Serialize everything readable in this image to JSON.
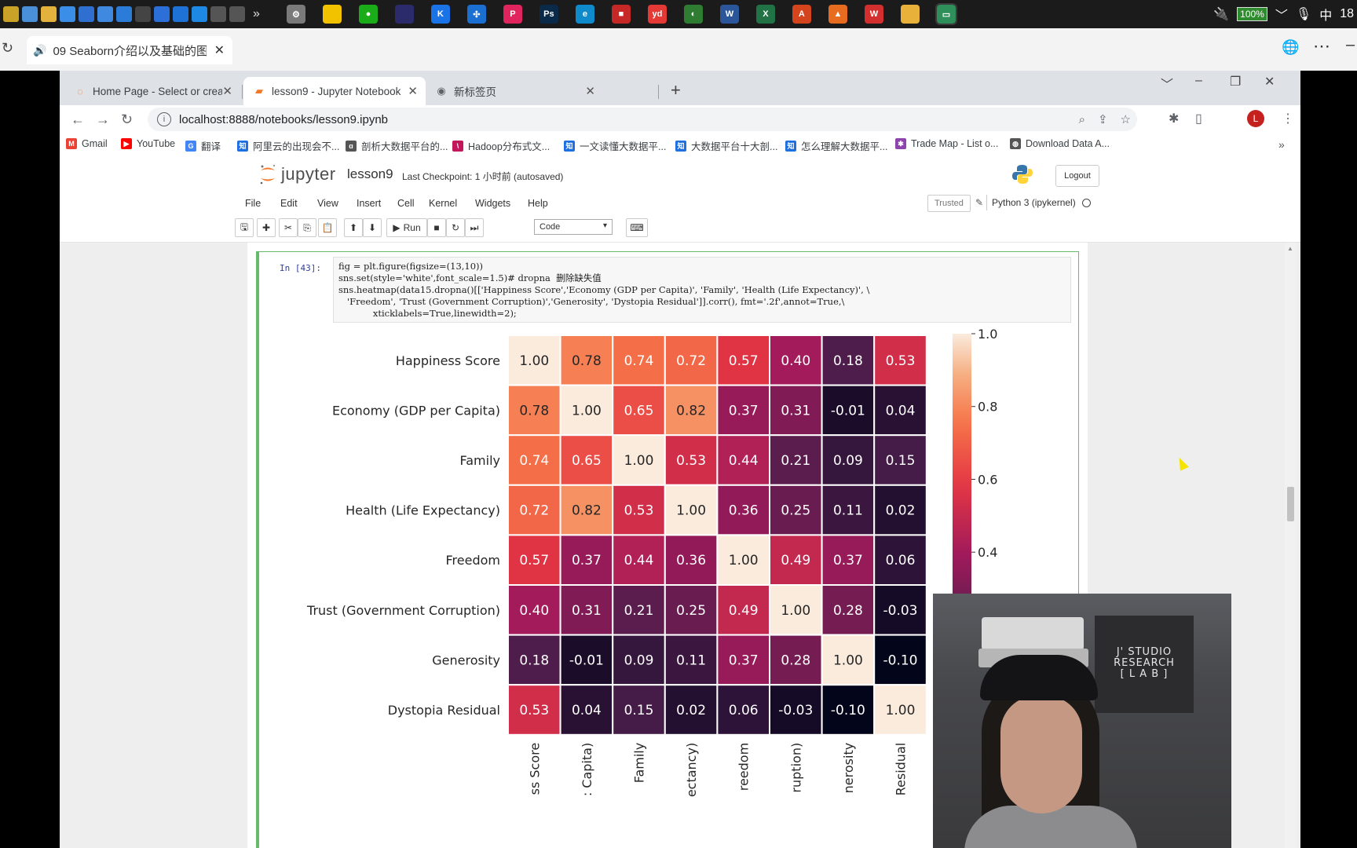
{
  "taskbar": {
    "quick_icons": [
      {
        "name": "file-icon",
        "color": "#c9a227"
      },
      {
        "name": "ship-icon",
        "color": "#4a90d9"
      },
      {
        "name": "folder-icon",
        "color": "#e2b23c"
      },
      {
        "name": "cloud-icon",
        "color": "#3b8ee8"
      },
      {
        "name": "box-icon",
        "color": "#2f6fcf"
      },
      {
        "name": "app-icon",
        "color": "#3f8ae0"
      },
      {
        "name": "monitor-icon",
        "color": "#2b7bd8"
      },
      {
        "name": "vue-icon",
        "color": "#444444"
      },
      {
        "name": "shield-icon",
        "color": "#2d6fd8"
      },
      {
        "name": "window-icon",
        "color": "#1e72d6"
      },
      {
        "name": "star-icon",
        "color": "#1e88e5"
      },
      {
        "name": "arrow-icon",
        "color": "#555555"
      },
      {
        "name": "share-icon",
        "color": "#555555"
      }
    ],
    "more": "»",
    "apps": [
      {
        "name": "settings-app",
        "color": "#7a7a7a",
        "glyph": "⚙"
      },
      {
        "name": "notes-app",
        "color": "#f2c200",
        "glyph": ""
      },
      {
        "name": "wechat-app",
        "color": "#1aad19",
        "glyph": "●"
      },
      {
        "name": "dark-app",
        "color": "#2b2b6b",
        "glyph": ""
      },
      {
        "name": "k-app",
        "color": "#1b73e8",
        "glyph": "K"
      },
      {
        "name": "puzzle-app",
        "color": "#1a6fd0",
        "glyph": "✣"
      },
      {
        "name": "red-app",
        "color": "#e0245e",
        "glyph": "P"
      },
      {
        "name": "ps-app",
        "color": "#0b2a4a",
        "glyph": "Ps"
      },
      {
        "name": "edge-app",
        "color": "#0f8bcc",
        "glyph": "e"
      },
      {
        "name": "red2-app",
        "color": "#c62828",
        "glyph": "■"
      },
      {
        "name": "youdao-app",
        "color": "#e53935",
        "glyph": "yd"
      },
      {
        "name": "green-app",
        "color": "#2e7d32",
        "glyph": "◐"
      },
      {
        "name": "word-app",
        "color": "#2b579a",
        "glyph": "W"
      },
      {
        "name": "excel-app",
        "color": "#217346",
        "glyph": "X"
      },
      {
        "name": "pdf-app",
        "color": "#d4451d",
        "glyph": "A"
      },
      {
        "name": "matlab-app",
        "color": "#e86c1f",
        "glyph": "▲"
      },
      {
        "name": "wps-app",
        "color": "#d32f2f",
        "glyph": "W"
      },
      {
        "name": "explorer-app",
        "color": "#e8b23a",
        "glyph": ""
      },
      {
        "name": "screen-app",
        "color": "#2f8f5b",
        "glyph": "▭"
      }
    ],
    "battery": "100%",
    "ime": "中",
    "clock": "18"
  },
  "outer_tab": {
    "title": "09 Seaborn介绍以及基础的图"
  },
  "chrome": {
    "tabs": [
      {
        "title": "Home Page - Select or create",
        "icon": "jupyter-icon",
        "color": "#f37726"
      },
      {
        "title": "lesson9 - Jupyter Notebook",
        "icon": "jupyter-icon",
        "color": "#f37726"
      },
      {
        "title": "新标签页",
        "icon": "chrome-icon",
        "color": "#5f6368"
      }
    ],
    "url": "localhost:8888/notebooks/lesson9.ipynb",
    "bookmarks": [
      {
        "label": "Gmail",
        "color": "#ea4335",
        "glyph": "M"
      },
      {
        "label": "YouTube",
        "color": "#ff0000",
        "glyph": "▶"
      },
      {
        "label": "翻译",
        "color": "#4285f4",
        "glyph": "G"
      },
      {
        "label": "阿里云的出现会不...",
        "color": "#1e6fe0",
        "glyph": "知"
      },
      {
        "label": "剖析大数据平台的...",
        "color": "#555555",
        "glyph": "ɑ"
      },
      {
        "label": "Hadoop分布式文...",
        "color": "#c2185b",
        "glyph": "\\"
      },
      {
        "label": "一文读懂大数据平...",
        "color": "#1e6fe0",
        "glyph": "知"
      },
      {
        "label": "大数据平台十大剖...",
        "color": "#1e6fe0",
        "glyph": "知"
      },
      {
        "label": "怎么理解大数据平...",
        "color": "#1e6fe0",
        "glyph": "知"
      },
      {
        "label": "Trade Map - List o...",
        "color": "#8e44ad",
        "glyph": "✱"
      },
      {
        "label": "Download Data A...",
        "color": "#555555",
        "glyph": "◍"
      }
    ]
  },
  "jupyter": {
    "logo_text": "jupyter",
    "notebook_name": "lesson9",
    "checkpoint": "Last Checkpoint: 1 小时前  (autosaved)",
    "logout": "Logout",
    "menu": [
      "File",
      "Edit",
      "View",
      "Insert",
      "Cell",
      "Kernel",
      "Widgets",
      "Help"
    ],
    "trusted": "Trusted",
    "kernel": "Python 3 (ipykernel)",
    "run_label": "Run",
    "cell_type": "Code"
  },
  "cell": {
    "prompt": "In  [43]:",
    "code_lines": [
      "fig = plt.figure(figsize=(13,10))",
      "sns.set(style='white',font_scale=1.5)# dropna  删除缺失值",
      "sns.heatmap(data15.dropna()[['Happiness Score','Economy (GDP per Capita)', 'Family', 'Health (Life Expectancy)', \\",
      "   'Freedom', 'Trust (Government Corruption)','Generosity', 'Dystopia Residual']].corr(), fmt='.2f',annot=True,\\",
      "            xticklabels=True,linewidth=2);"
    ]
  },
  "chart_data": {
    "type": "heatmap",
    "row_labels": [
      "Happiness Score",
      "Economy (GDP per Capita)",
      "Family",
      "Health (Life Expectancy)",
      "Freedom",
      "Trust (Government Corruption)",
      "Generosity",
      "Dystopia Residual"
    ],
    "col_labels_visible": [
      "ss Score",
      ": Capita)",
      "Family",
      "ectancy)",
      "reedom",
      "ruption)",
      "nerosity",
      "Residual"
    ],
    "values": [
      [
        1.0,
        0.78,
        0.74,
        0.72,
        0.57,
        0.4,
        0.18,
        0.53
      ],
      [
        0.78,
        1.0,
        0.65,
        0.82,
        0.37,
        0.31,
        -0.01,
        0.04
      ],
      [
        0.74,
        0.65,
        1.0,
        0.53,
        0.44,
        0.21,
        0.09,
        0.15
      ],
      [
        0.72,
        0.82,
        0.53,
        1.0,
        0.36,
        0.25,
        0.11,
        0.02
      ],
      [
        0.57,
        0.37,
        0.44,
        0.36,
        1.0,
        0.49,
        0.37,
        0.06
      ],
      [
        0.4,
        0.31,
        0.21,
        0.25,
        0.49,
        1.0,
        0.28,
        -0.03
      ],
      [
        0.18,
        -0.01,
        0.09,
        0.11,
        0.37,
        0.28,
        1.0,
        -0.1
      ],
      [
        0.53,
        0.04,
        0.15,
        0.02,
        0.06,
        -0.03,
        -0.1,
        1.0
      ]
    ],
    "colorbar_ticks": [
      "1.0",
      "0.8",
      "0.6",
      "0.4"
    ],
    "vmin": -0.1,
    "vmax": 1.0,
    "colormap": "rocket"
  },
  "webcam": {
    "sign": [
      "J' STUDIO",
      "RESEARCH",
      "[ L A B ]"
    ]
  }
}
